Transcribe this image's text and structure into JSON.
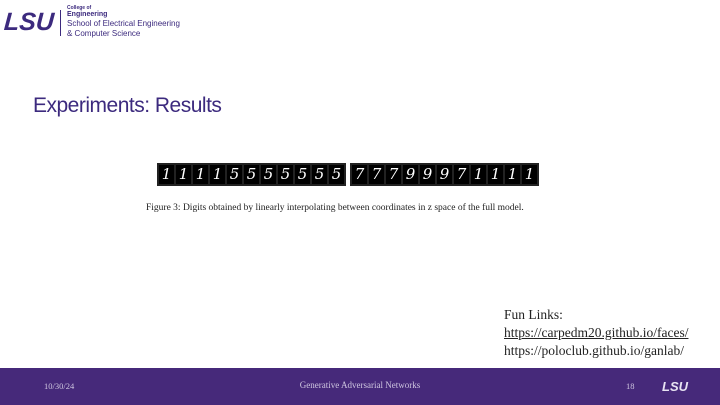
{
  "header": {
    "logo": "LSU",
    "college_small": "College of",
    "college_name": "Engineering",
    "school_line1": "School of Electrical Engineering",
    "school_line2": "& Computer Science"
  },
  "slide": {
    "title": "Experiments: Results",
    "figure": {
      "strip_left": [
        "1",
        "1",
        "1",
        "1",
        "5",
        "5",
        "5",
        "5",
        "5",
        "5",
        "5"
      ],
      "strip_right": [
        "7",
        "7",
        "7",
        "9",
        "9",
        "9",
        "7",
        "1",
        "1",
        "1",
        "1"
      ],
      "caption": "Figure 3: Digits obtained by linearly interpolating between coordinates in z space of the full model."
    },
    "links": {
      "heading": "Fun Links:",
      "link1": "https://carpedm20.github.io/faces/",
      "link2": "https://poloclub.github.io/ganlab/"
    }
  },
  "footer": {
    "date": "10/30/24",
    "center": "Generative Adversarial Networks",
    "page": "18",
    "logo": "LSU"
  },
  "colors": {
    "brand_purple": "#3c2a7e",
    "footer_bg": "#46297a"
  }
}
